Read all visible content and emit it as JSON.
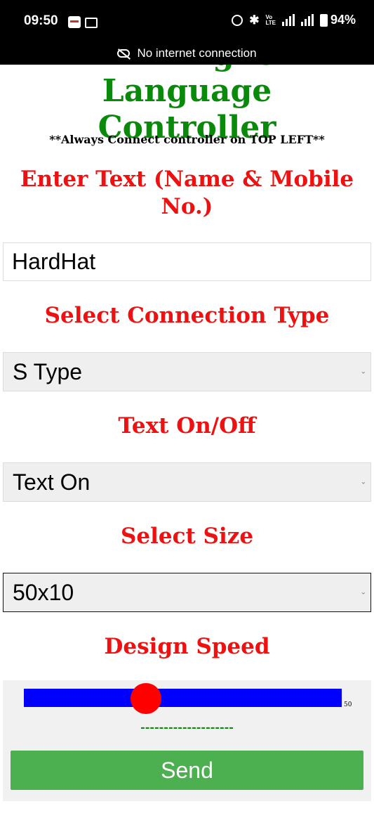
{
  "status_bar": {
    "time": "09:50",
    "battery_percent": "94%",
    "volte_label": "Vo LTE",
    "network_notice": "No internet connection"
  },
  "page": {
    "title": "Controller",
    "title_partial_above": "WiFi English Language",
    "notice": "**Always Connect controller on TOP LEFT**",
    "text_section": {
      "heading": "Enter Text (Name & Mobile No.)",
      "value": "HardHat"
    },
    "connection_section": {
      "heading": "Select Connection Type",
      "selected": "S Type"
    },
    "text_toggle_section": {
      "heading": "Text On/Off",
      "selected": "Text On"
    },
    "size_section": {
      "heading": "Select Size",
      "selected": "50x10"
    },
    "speed_section": {
      "heading": "Design Speed",
      "slider_value": "50",
      "slider_fraction": 0.38,
      "dash_text": "--------------------",
      "send_label": "Send"
    }
  },
  "colors": {
    "title": "#0a8a0a",
    "heading": "#ee1111",
    "slider_track": "#0000ff",
    "slider_thumb": "#ff0000",
    "send_button": "#4caf50"
  }
}
